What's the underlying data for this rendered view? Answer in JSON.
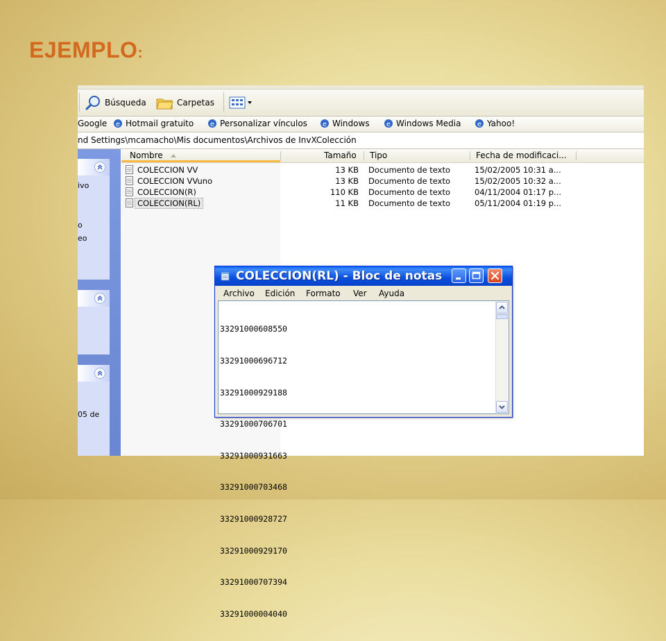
{
  "slide": {
    "title": "EJEMPLO",
    "title_suffix": ":"
  },
  "toolbar": {
    "search_label": "Búsqueda",
    "folders_label": "Carpetas"
  },
  "links": [
    {
      "label": "Google"
    },
    {
      "label": "Hotmail gratuito"
    },
    {
      "label": "Personalizar vínculos"
    },
    {
      "label": "Windows"
    },
    {
      "label": "Windows Media"
    },
    {
      "label": "Yahoo!"
    }
  ],
  "address": {
    "path": "nd Settings\\mcamacho\\Mis documentos\\Archivos de InvXColección"
  },
  "left_pane": {
    "frag1": "ivo",
    "frag2": "o",
    "frag3": "eo",
    "frag4": "05 de"
  },
  "columns": {
    "name": "Nombre",
    "size": "Tamaño",
    "type": "Tipo",
    "date": "Fecha de modificaci..."
  },
  "files": [
    {
      "name": "COLECCION VV",
      "size": "13 KB",
      "type": "Documento de texto",
      "date": "15/02/2005 10:31 a..."
    },
    {
      "name": "COLECCION VVuno",
      "size": "13 KB",
      "type": "Documento de texto",
      "date": "15/02/2005 10:32 a..."
    },
    {
      "name": "COLECCION(R)",
      "size": "110 KB",
      "type": "Documento de texto",
      "date": "04/11/2004 01:17 p..."
    },
    {
      "name": "COLECCION(RL)",
      "size": "11 KB",
      "type": "Documento de texto",
      "date": "05/11/2004 01:19 p..."
    }
  ],
  "notepad": {
    "title": "COLECCION(RL) - Bloc de notas",
    "menu": [
      "Archivo",
      "Edición",
      "Formato",
      "Ver",
      "Ayuda"
    ],
    "lines": [
      "33291000608550",
      "33291000696712",
      "33291000929188",
      "33291000706701",
      "33291000931663",
      "33291000703468",
      "33291000928727",
      "33291000929170",
      "33291000707394",
      "33291000004040"
    ]
  }
}
